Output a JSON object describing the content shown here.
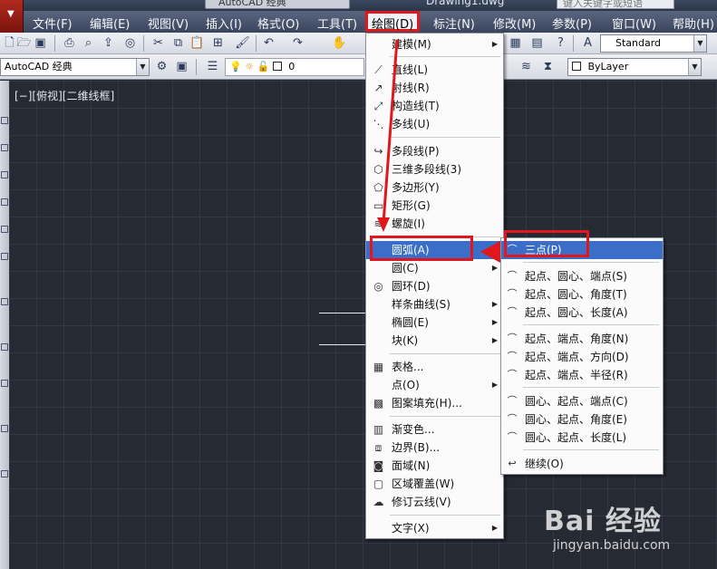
{
  "title_bar": {
    "workspace_field": "AutoCAD 经典",
    "document_title": "Drawing1.dwg",
    "help_search_placeholder": "键入关键字或短语"
  },
  "menubar": {
    "items": [
      {
        "label": "文件(F)"
      },
      {
        "label": "编辑(E)"
      },
      {
        "label": "视图(V)"
      },
      {
        "label": "插入(I)"
      },
      {
        "label": "格式(O)"
      },
      {
        "label": "工具(T)"
      },
      {
        "label": "绘图(D)"
      },
      {
        "label": "标注(N)"
      },
      {
        "label": "修改(M)"
      },
      {
        "label": "参数(P)"
      },
      {
        "label": "窗口(W)"
      },
      {
        "label": "帮助(H)"
      }
    ],
    "active": "绘图(D)"
  },
  "toolbar": {
    "text_style": "Standard",
    "workspace": "AutoCAD 经典",
    "layer": "0",
    "color": "ByLayer"
  },
  "viewport": {
    "label": "[−][俯视][二维线框]"
  },
  "draw_menu": {
    "items": [
      {
        "label": "建模(M)",
        "icon": "none",
        "submenu": true
      },
      {
        "label": "直线(L)",
        "icon": "line-icon"
      },
      {
        "label": "射线(R)",
        "icon": "ray-icon"
      },
      {
        "label": "构造线(T)",
        "icon": "xline-icon"
      },
      {
        "label": "多线(U)",
        "icon": "multiline-icon"
      },
      {
        "label": "多段线(P)",
        "icon": "polyline-icon"
      },
      {
        "label": "三维多段线(3)",
        "icon": "3d-polyline-icon"
      },
      {
        "label": "多边形(Y)",
        "icon": "polygon-icon"
      },
      {
        "label": "矩形(G)",
        "icon": "rectangle-icon"
      },
      {
        "label": "螺旋(I)",
        "icon": "helix-icon"
      },
      {
        "label": "圆弧(A)",
        "icon": "none",
        "submenu": true,
        "highlighted": true
      },
      {
        "label": "圆(C)",
        "icon": "none",
        "submenu": true
      },
      {
        "label": "圆环(D)",
        "icon": "donut-icon"
      },
      {
        "label": "样条曲线(S)",
        "icon": "none",
        "submenu": true
      },
      {
        "label": "椭圆(E)",
        "icon": "none",
        "submenu": true
      },
      {
        "label": "块(K)",
        "icon": "none",
        "submenu": true
      },
      {
        "label": "表格...",
        "icon": "table-icon"
      },
      {
        "label": "点(O)",
        "icon": "none",
        "submenu": true
      },
      {
        "label": "图案填充(H)...",
        "icon": "hatch-icon"
      },
      {
        "label": "渐变色...",
        "icon": "gradient-icon"
      },
      {
        "label": "边界(B)...",
        "icon": "boundary-icon"
      },
      {
        "label": "面域(N)",
        "icon": "region-icon"
      },
      {
        "label": "区域覆盖(W)",
        "icon": "wipeout-icon"
      },
      {
        "label": "修订云线(V)",
        "icon": "revcloud-icon"
      },
      {
        "label": "文字(X)",
        "icon": "none",
        "submenu": true
      }
    ]
  },
  "arc_menu": {
    "items": [
      {
        "label": "三点(P)",
        "highlighted": true
      },
      {
        "label": "起点、圆心、端点(S)"
      },
      {
        "label": "起点、圆心、角度(T)"
      },
      {
        "label": "起点、圆心、长度(A)"
      },
      {
        "label": "起点、端点、角度(N)"
      },
      {
        "label": "起点、端点、方向(D)"
      },
      {
        "label": "起点、端点、半径(R)"
      },
      {
        "label": "圆心、起点、端点(C)"
      },
      {
        "label": "圆心、起点、角度(E)"
      },
      {
        "label": "圆心、起点、长度(L)"
      },
      {
        "label": "继续(O)"
      }
    ]
  },
  "watermark": {
    "brand": "Bai 经验",
    "url": "jingyan.baidu.com"
  },
  "colors": {
    "highlight": "#3b6ec9",
    "annotation_red": "#e0181d",
    "canvas": "#262a33"
  }
}
